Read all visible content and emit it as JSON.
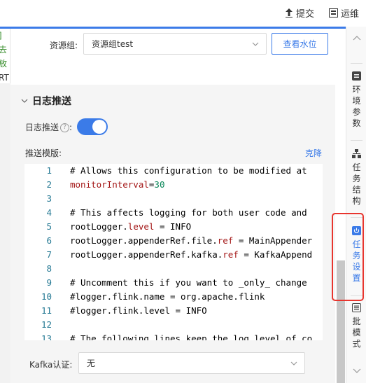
{
  "topbar": {
    "submit_label": "提交",
    "ops_label": "运维"
  },
  "left_panel": {
    "lines": [
      "]",
      "去",
      "放",
      "RT"
    ]
  },
  "resource": {
    "label": "资源组:",
    "value": "资源组test",
    "view_button": "查看水位"
  },
  "log_section": {
    "title": "日志推送",
    "toggle_label": "日志推送",
    "help_mark": "?",
    "colon": ":",
    "toggle_on": true,
    "template_label": "推送模版:",
    "downgrade_link": "克降"
  },
  "code_lines": [
    {
      "n": "1",
      "text": "# Allows this configuration to be modified at"
    },
    {
      "n": "2",
      "text": "monitorInterval=30"
    },
    {
      "n": "3",
      "text": ""
    },
    {
      "n": "4",
      "text": "# This affects logging for both user code and"
    },
    {
      "n": "5",
      "text": "rootLogger.level = INFO"
    },
    {
      "n": "6",
      "text": "rootLogger.appenderRef.file.ref = MainAppender"
    },
    {
      "n": "7",
      "text": "rootLogger.appenderRef.kafka.ref = KafkaAppend"
    },
    {
      "n": "8",
      "text": ""
    },
    {
      "n": "9",
      "text": "# Uncomment this if you want to _only_ change"
    },
    {
      "n": "10",
      "text": "#logger.flink.name = org.apache.flink"
    },
    {
      "n": "11",
      "text": "#logger.flink.level = INFO"
    },
    {
      "n": "12",
      "text": ""
    },
    {
      "n": "13",
      "text": "# The following lines keep the log level of co"
    }
  ],
  "kafka": {
    "label": "Kafka认证:",
    "value": "无"
  },
  "right_sidebar": {
    "env_params": "环境参数",
    "task_structure": "任务结构",
    "task_settings": "任务设置",
    "batch_mode": "批模式"
  },
  "colors": {
    "accent": "#3b7be8",
    "highlight_box": "#e8352e",
    "comment": "#008000"
  }
}
